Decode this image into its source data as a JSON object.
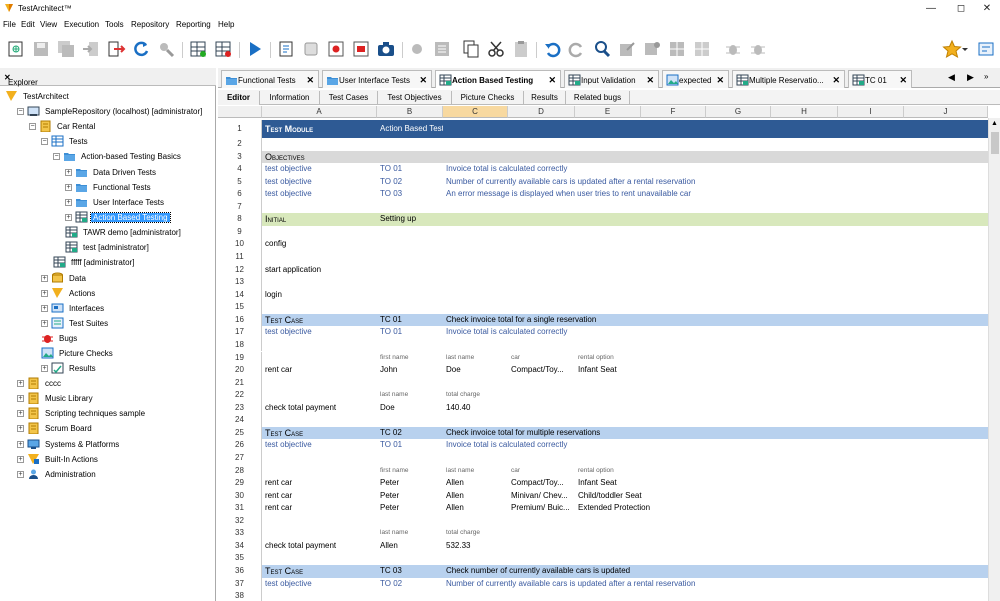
{
  "window": {
    "title": "TestArchitect™"
  },
  "menu": [
    "File",
    "Edit",
    "View",
    "Execution",
    "Tools",
    "Repository",
    "Reporting",
    "Help"
  ],
  "explorer": {
    "title": "Explorer"
  },
  "tree": [
    {
      "label": "TestArchitect",
      "depth": 0,
      "icon": "testarchitect-icon",
      "exp": ""
    },
    {
      "label": "SampleRepository (localhost) [administrator]",
      "depth": 1,
      "icon": "repository-icon",
      "exp": "-"
    },
    {
      "label": "Car Rental",
      "depth": 2,
      "icon": "project-icon",
      "exp": "-"
    },
    {
      "label": "Tests",
      "depth": 3,
      "icon": "tests-icon",
      "exp": "-"
    },
    {
      "label": "Action-based Testing Basics",
      "depth": 4,
      "icon": "folder-icon",
      "exp": "-"
    },
    {
      "label": "Data Driven Tests",
      "depth": 5,
      "icon": "folder-icon",
      "exp": "+"
    },
    {
      "label": "Functional Tests",
      "depth": 5,
      "icon": "folder-icon",
      "exp": "+"
    },
    {
      "label": "User Interface Tests",
      "depth": 5,
      "icon": "folder-icon",
      "exp": "+"
    },
    {
      "label": "Action Based Testing",
      "depth": 5,
      "icon": "test-module-icon",
      "exp": "+",
      "selected": true
    },
    {
      "label": "TAWR demo [administrator]",
      "depth": 5,
      "icon": "test-module-icon",
      "exp": ""
    },
    {
      "label": "test [administrator]",
      "depth": 5,
      "icon": "test-module-icon",
      "exp": ""
    },
    {
      "label": "fffff [administrator]",
      "depth": 4,
      "icon": "test-module-icon",
      "exp": ""
    },
    {
      "label": "Data",
      "depth": 3,
      "icon": "data-icon",
      "exp": "+"
    },
    {
      "label": "Actions",
      "depth": 3,
      "icon": "actions-icon",
      "exp": "+"
    },
    {
      "label": "Interfaces",
      "depth": 3,
      "icon": "interfaces-icon",
      "exp": "+"
    },
    {
      "label": "Test Suites",
      "depth": 3,
      "icon": "test-suites-icon",
      "exp": "+"
    },
    {
      "label": "Bugs",
      "depth": 3,
      "icon": "bug-icon",
      "exp": ""
    },
    {
      "label": "Picture Checks",
      "depth": 3,
      "icon": "picture-icon",
      "exp": ""
    },
    {
      "label": "Results",
      "depth": 3,
      "icon": "results-icon",
      "exp": "+"
    },
    {
      "label": "cccc",
      "depth": 1,
      "icon": "project-icon",
      "exp": "+"
    },
    {
      "label": "Music Library",
      "depth": 1,
      "icon": "project-icon",
      "exp": "+"
    },
    {
      "label": "Scripting techniques sample",
      "depth": 1,
      "icon": "project-icon",
      "exp": "+"
    },
    {
      "label": "Scrum Board",
      "depth": 1,
      "icon": "project-icon",
      "exp": "+"
    },
    {
      "label": "Systems & Platforms",
      "depth": 1,
      "icon": "systems-icon",
      "exp": "+"
    },
    {
      "label": "Built-In Actions",
      "depth": 1,
      "icon": "builtin-icon",
      "exp": "+"
    },
    {
      "label": "Administration",
      "depth": 1,
      "icon": "admin-icon",
      "exp": "+"
    }
  ],
  "tabs": [
    {
      "label": "Functional Tests",
      "icon": "folder-icon"
    },
    {
      "label": "User Interface Tests",
      "icon": "folder-icon"
    },
    {
      "label": "Action Based Testing",
      "icon": "test-module-icon",
      "active": true
    },
    {
      "label": "Input Validation",
      "icon": "test-module-icon"
    },
    {
      "label": "expected",
      "icon": "picture-icon"
    },
    {
      "label": "Multiple Reservatio...",
      "icon": "test-module-icon"
    },
    {
      "label": "TC 01",
      "icon": "test-module-icon"
    }
  ],
  "subtabs": [
    "Editor",
    "Information",
    "Test Cases",
    "Test Objectives",
    "Picture Checks",
    "Results",
    "Related bugs"
  ],
  "columns": [
    "A",
    "B",
    "C",
    "D",
    "E",
    "F",
    "G",
    "H",
    "I",
    "J"
  ],
  "selected_column": "C",
  "colors": {
    "module_header": "#2e5a94",
    "section_gray": "#d9d9d9",
    "initial_green": "#d8e8bc",
    "testcase_blue": "#b8d1ee",
    "link_blue": "#3a5aa0"
  },
  "rows": [
    {
      "n": "1",
      "style": "module",
      "cells": [
        "Test Module",
        "Action Based Testing",
        "",
        ""
      ]
    },
    {
      "n": "2",
      "cells": []
    },
    {
      "n": "3",
      "style": "gray",
      "cells": [
        "Objectives"
      ]
    },
    {
      "n": "4",
      "style": "link",
      "cells": [
        "test objective",
        "TO 01",
        "Invoice total is calculated correctly"
      ]
    },
    {
      "n": "5",
      "style": "link",
      "cells": [
        "test objective",
        "TO 02",
        "Number of currently available cars is updated after a rental reservation"
      ]
    },
    {
      "n": "6",
      "style": "link",
      "cells": [
        "test objective",
        "TO 03",
        "An error message is displayed when user tries to rent unavailable car"
      ]
    },
    {
      "n": "7",
      "cells": []
    },
    {
      "n": "8",
      "style": "green",
      "cells": [
        "Initial",
        "Setting up"
      ]
    },
    {
      "n": "9",
      "cells": []
    },
    {
      "n": "10",
      "cells": [
        "config"
      ]
    },
    {
      "n": "11",
      "cells": []
    },
    {
      "n": "12",
      "cells": [
        "start application"
      ]
    },
    {
      "n": "13",
      "cells": []
    },
    {
      "n": "14",
      "cells": [
        "login"
      ]
    },
    {
      "n": "15",
      "cells": []
    },
    {
      "n": "16",
      "style": "tc",
      "cells": [
        "Test Case",
        "TC 01",
        "Check invoice total for a single reservation"
      ]
    },
    {
      "n": "17",
      "style": "link",
      "cells": [
        "test objective",
        "TO 01",
        "Invoice total is calculated correctly"
      ]
    },
    {
      "n": "18",
      "cells": []
    },
    {
      "n": "19",
      "style": "small",
      "cells": [
        "",
        "first name",
        "last name",
        "car",
        "rental option"
      ]
    },
    {
      "n": "20",
      "cells": [
        "rent car",
        "John",
        "Doe",
        "Compact/Toy...",
        "Infant Seat"
      ]
    },
    {
      "n": "21",
      "cells": []
    },
    {
      "n": "22",
      "style": "small",
      "cells": [
        "",
        "last name",
        "total charge"
      ]
    },
    {
      "n": "23",
      "cells": [
        "check total payment",
        "Doe",
        "140.40"
      ]
    },
    {
      "n": "24",
      "cells": []
    },
    {
      "n": "25",
      "style": "tc",
      "cells": [
        "Test Case",
        "TC 02",
        "Check invoice total for multiple reservations"
      ]
    },
    {
      "n": "26",
      "style": "link",
      "cells": [
        "test objective",
        "TO 01",
        "Invoice total is calculated correctly"
      ]
    },
    {
      "n": "27",
      "cells": []
    },
    {
      "n": "28",
      "style": "small",
      "cells": [
        "",
        "first name",
        "last name",
        "car",
        "rental option"
      ]
    },
    {
      "n": "29",
      "cells": [
        "rent car",
        "Peter",
        "Allen",
        "Compact/Toy...",
        "Infant Seat"
      ]
    },
    {
      "n": "30",
      "cells": [
        "rent car",
        "Peter",
        "Allen",
        "Minivan/ Chev...",
        "Child/toddler Seat"
      ]
    },
    {
      "n": "31",
      "cells": [
        "rent car",
        "Peter",
        "Allen",
        "Premium/ Buic...",
        "Extended Protection"
      ]
    },
    {
      "n": "32",
      "cells": []
    },
    {
      "n": "33",
      "style": "small",
      "cells": [
        "",
        "last name",
        "total charge"
      ]
    },
    {
      "n": "34",
      "cells": [
        "check total payment",
        "Allen",
        "532.33"
      ]
    },
    {
      "n": "35",
      "cells": []
    },
    {
      "n": "36",
      "style": "tc",
      "cells": [
        "Test Case",
        "TC 03",
        "Check number of currently available cars is updated"
      ]
    },
    {
      "n": "37",
      "style": "link",
      "cells": [
        "test objective",
        "TO 02",
        "Number of currently available cars is updated after a rental reservation"
      ]
    },
    {
      "n": "38",
      "cells": []
    }
  ]
}
